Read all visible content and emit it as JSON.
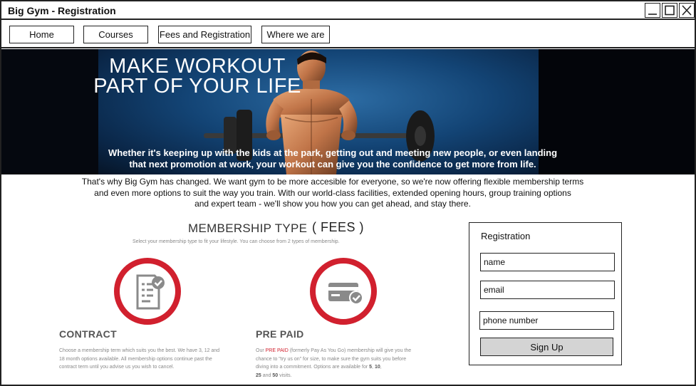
{
  "window": {
    "title": "Big Gym - Registration"
  },
  "nav": {
    "items": [
      "Home",
      "Courses",
      "Fees and Registration",
      "Where we are"
    ]
  },
  "hero": {
    "title_line1": "MAKE WORKOUT",
    "title_line2": "PART OF YOUR LIFE",
    "caption_line1": "Whether it's keeping up with the kids at the park, getting out and meeting new people, or even landing",
    "caption_line2": "that next promotion at work, your workout can give you the confidence to get more from life."
  },
  "intro": {
    "line1": "That's why Big Gym has changed. We want gym to be more accesible for everyone, so we're now offering flexible membership terms",
    "line2": "and even more options to suit the way you train. With our world-class facilities, extended opening hours, group training options",
    "line3": "and expert team - we'll show you how you can get ahead, and stay there."
  },
  "membership": {
    "title": "MEMBERSHIP TYPE",
    "fees": "( FEES )",
    "subtitle": "Select your membership type to fit your lifestyle. You can choose from 2 types of membership.",
    "contract": {
      "heading": "CONTRACT",
      "line1": "Choose a membership term which suits you the best. We have 3, 12 and",
      "line2": "18 month options available. All membership options continue past the",
      "line3": "contract term until you advise us you wish to cancel."
    },
    "prepaid": {
      "heading": "PRE PAID",
      "line1_a": "Our ",
      "line1_red": "PRE PAID",
      "line1_b": " (formerly Pay As You Go) membership will give you the",
      "line2": "chance to \"try us on\" for size, to make sure the gym suits you before",
      "line3_a": "diving into a commitment. Options are available for ",
      "line3_b1": "5",
      "line3_sep": ", ",
      "line3_b2": "10",
      "line3_c": ",",
      "line4_b1": "25",
      "line4_a": " and ",
      "line4_b2": "50",
      "line4_c": " visits."
    },
    "accent_color": "#d1202e",
    "icon_color": "#8a8a8a"
  },
  "registration": {
    "title": "Registration",
    "name_placeholder": "name",
    "email_placeholder": "email",
    "phone_placeholder": "phone number",
    "submit_label": "Sign Up"
  },
  "icons": [
    "minimize-icon",
    "maximize-icon",
    "close-icon",
    "contract-document-icon",
    "credit-card-icon"
  ]
}
